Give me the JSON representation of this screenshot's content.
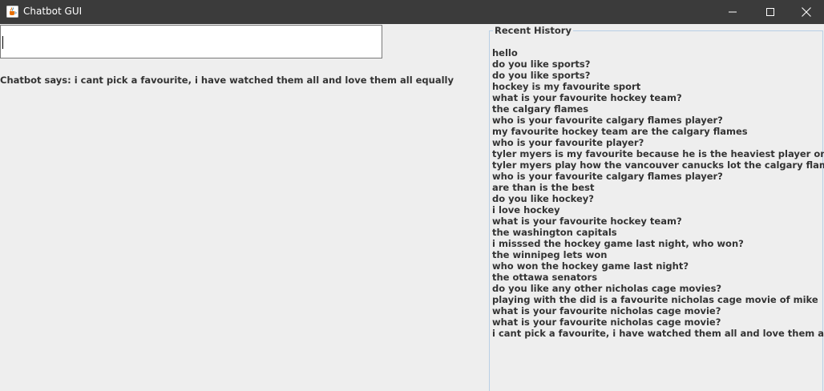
{
  "window": {
    "title": "Chatbot GUI",
    "icon": "java-cup-icon"
  },
  "controls": {
    "minimize_icon": "minimize-icon",
    "maximize_icon": "maximize-icon",
    "close_icon": "close-icon"
  },
  "input": {
    "value": ""
  },
  "response": {
    "text": "Chatbot says: i cant pick a favourite, i have watched them all and love them all equally"
  },
  "history": {
    "title": "Recent History",
    "items": [
      "hello",
      "do you like sports?",
      "do you like sports?",
      "hockey is my favourite sport",
      "what is your favourite hockey team?",
      "the calgary flames",
      "who is your favourite calgary flames player?",
      "my favourite hockey team are the calgary flames",
      "who is your favourite player?",
      "tyler myers is my favourite because he is the heaviest player on the team",
      "tyler myers play how the vancouver canucks lot the calgary flames",
      "who is your favourite calgary flames player?",
      "are than is the best",
      "do you like hockey?",
      "i love hockey",
      "what is your favourite hockey team?",
      "the washington capitals",
      "i misssed the hockey game last night, who won?",
      "the winnipeg lets won",
      "who won the hockey game last night?",
      "the ottawa senators",
      "do you like any other nicholas cage movies?",
      "playing with the did is a favourite nicholas cage movie of mike",
      "what is your favourite nicholas cage movie?",
      "what is your favourite nicholas cage movie?",
      "i cant pick a favourite, i have watched them all and love them all equally"
    ]
  },
  "colors": {
    "titlebar": "#3b3b3b",
    "background": "#eeeeee",
    "text": "#333333",
    "panel_border": "#b8cfe5"
  }
}
